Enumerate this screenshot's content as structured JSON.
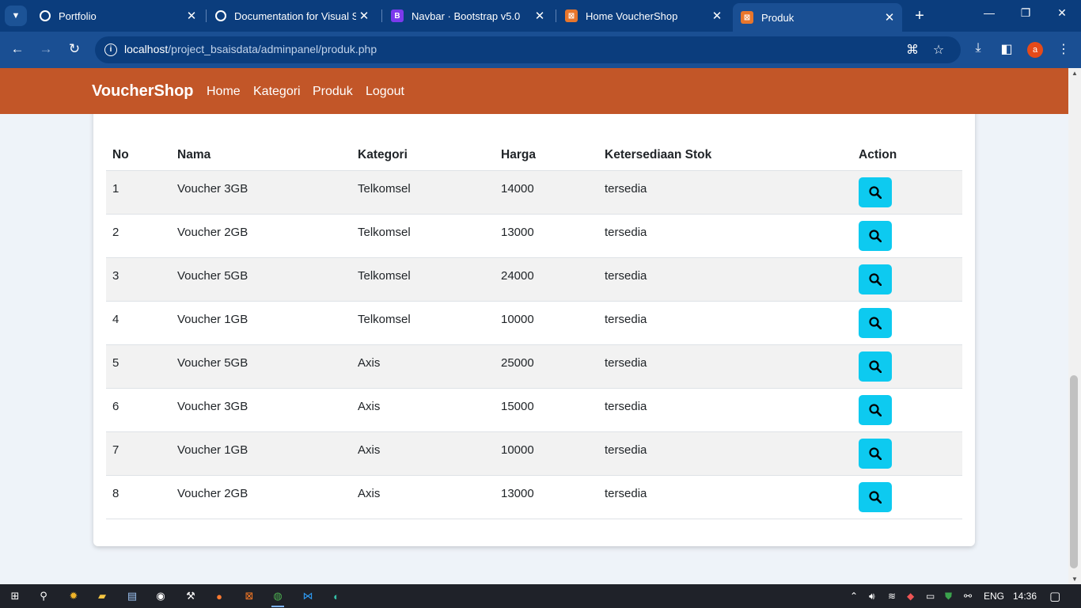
{
  "browser": {
    "tabs": [
      {
        "title": "Portfolio",
        "icon": "globe-icon"
      },
      {
        "title": "Documentation for Visual Stu",
        "icon": "globe-icon"
      },
      {
        "title": "Navbar · Bootstrap v5.0",
        "icon": "bootstrap-icon"
      },
      {
        "title": "Home VoucherShop",
        "icon": "xampp-icon"
      },
      {
        "title": "Produk",
        "icon": "xampp-icon",
        "active": true
      }
    ],
    "url_host": "localhost",
    "url_path": "/project_bsaisdata/adminpanel/produk.php",
    "profile_initial": "a"
  },
  "navbar": {
    "brand": "VoucherShop",
    "links": [
      "Home",
      "Kategori",
      "Produk",
      "Logout"
    ],
    "color": "#c25628"
  },
  "table": {
    "headers": [
      "No",
      "Nama",
      "Kategori",
      "Harga",
      "Ketersediaan Stok",
      "Action"
    ],
    "rows": [
      {
        "no": "1",
        "nama": "Voucher 3GB",
        "kategori": "Telkomsel",
        "harga": "14000",
        "stok": "tersedia"
      },
      {
        "no": "2",
        "nama": "Voucher 2GB",
        "kategori": "Telkomsel",
        "harga": "13000",
        "stok": "tersedia"
      },
      {
        "no": "3",
        "nama": "Voucher 5GB",
        "kategori": "Telkomsel",
        "harga": "24000",
        "stok": "tersedia"
      },
      {
        "no": "4",
        "nama": "Voucher 1GB",
        "kategori": "Telkomsel",
        "harga": "10000",
        "stok": "tersedia"
      },
      {
        "no": "5",
        "nama": "Voucher 5GB",
        "kategori": "Axis",
        "harga": "25000",
        "stok": "tersedia"
      },
      {
        "no": "6",
        "nama": "Voucher 3GB",
        "kategori": "Axis",
        "harga": "15000",
        "stok": "tersedia"
      },
      {
        "no": "7",
        "nama": "Voucher 1GB",
        "kategori": "Axis",
        "harga": "10000",
        "stok": "tersedia"
      },
      {
        "no": "8",
        "nama": "Voucher 2GB",
        "kategori": "Axis",
        "harga": "13000",
        "stok": "tersedia"
      }
    ],
    "action_color": "#0dcaf0"
  },
  "taskbar": {
    "language": "ENG",
    "time": "14:36"
  }
}
